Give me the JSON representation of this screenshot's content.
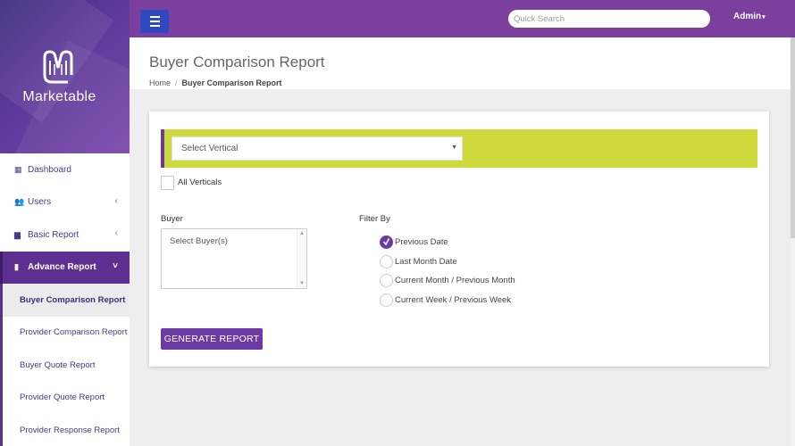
{
  "brand": {
    "name": "Marketable",
    "colors": {
      "sidebar_brand": "#5e3a9a",
      "topbar": "#7b3f9e",
      "accent": "#6a3aa5",
      "vertical_bar": "#cfdb3d",
      "menu_button": "#2f49c0"
    }
  },
  "topbar": {
    "menu_icon": "hamburger-icon",
    "search_placeholder": "Quick Search",
    "admin_label": "Admin",
    "admin_caret": "▾"
  },
  "sidebar": {
    "items": [
      {
        "label": "Dashboard",
        "icon": "dashboard-grid-icon",
        "glyph": "▦",
        "caret": ""
      },
      {
        "label": "Users",
        "icon": "users-icon",
        "glyph": "👥",
        "caret": "‹"
      },
      {
        "label": "Basic Report",
        "icon": "folder-icon",
        "glyph": "▆",
        "caret": "‹"
      },
      {
        "label": "Advance Report",
        "icon": "file-icon",
        "glyph": "▮",
        "caret": "˅"
      }
    ],
    "subitems": [
      "Buyer Comparison Report",
      "Provider Comparison Report",
      "Buyer Quote Report",
      "Provider Quote Report",
      "Provider Response Report"
    ]
  },
  "page": {
    "title": "Buyer Comparison Report",
    "breadcrumb": {
      "home": "Home",
      "separator": "/",
      "current": "Buyer Comparison Report"
    }
  },
  "form": {
    "vertical_select": {
      "selected": "Select Vertical",
      "arrow": "▼"
    },
    "all_verticals_label": "All Verticals",
    "all_verticals_checked": false,
    "buyer_label": "Buyer",
    "buyer_placeholder": "Select Buyer(s)",
    "filter_label": "Filter By",
    "filter_options": [
      {
        "label": "Previous Date",
        "checked": true
      },
      {
        "label": "Last Month Date",
        "checked": false
      },
      {
        "label": "Current Month / Previous Month",
        "checked": false
      },
      {
        "label": "Current Week / Previous Week",
        "checked": false
      }
    ],
    "generate_button": "GENERATE REPORT"
  }
}
